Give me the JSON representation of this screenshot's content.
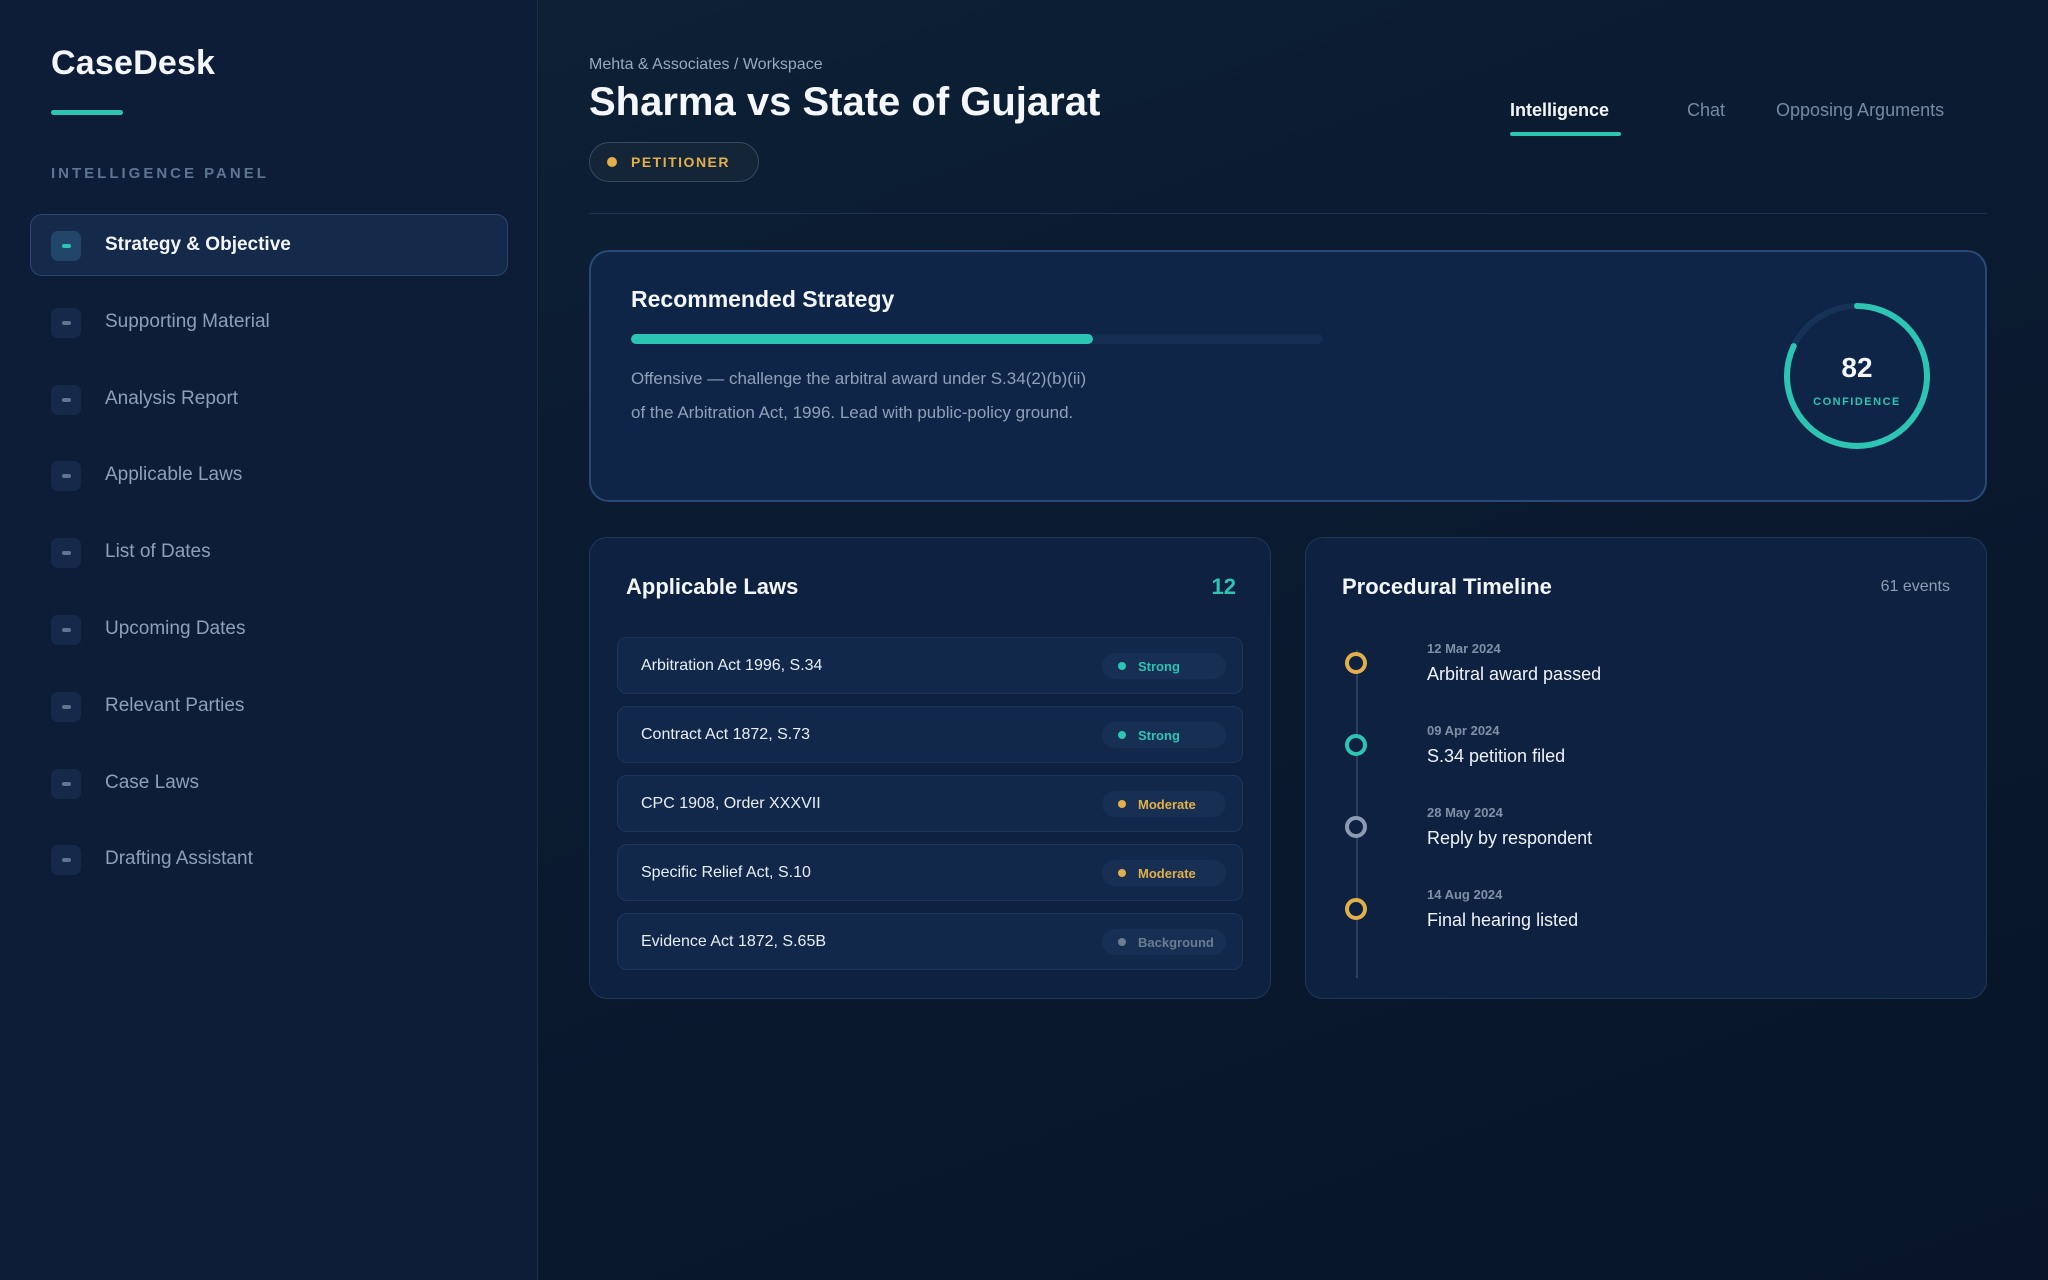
{
  "app": {
    "name": "CaseDesk"
  },
  "sidebar": {
    "panel_label": "INTELLIGENCE PANEL",
    "items": [
      {
        "label": "Strategy & Objective",
        "active": true
      },
      {
        "label": "Supporting Material"
      },
      {
        "label": "Analysis Report"
      },
      {
        "label": "Applicable Laws"
      },
      {
        "label": "List of Dates"
      },
      {
        "label": "Upcoming Dates"
      },
      {
        "label": "Relevant Parties"
      },
      {
        "label": "Case Laws"
      },
      {
        "label": "Drafting Assistant"
      }
    ]
  },
  "header": {
    "breadcrumb": "Mehta & Associates / Workspace",
    "title": "Sharma vs State of Gujarat",
    "role_badge": "PETITIONER",
    "tabs": [
      {
        "label": "Intelligence",
        "active": true
      },
      {
        "label": "Chat"
      },
      {
        "label": "Opposing Arguments"
      }
    ]
  },
  "strategy": {
    "title": "Recommended Strategy",
    "progress_fraction": 0.667,
    "description_line1": "Offensive — challenge the arbitral award under S.34(2)(b)(ii)",
    "description_line2": "of the Arbitration Act, 1996. Lead with public-policy ground.",
    "confidence_value": "82",
    "confidence_label": "CONFIDENCE",
    "confidence_fraction": 0.82
  },
  "laws": {
    "title": "Applicable Laws",
    "count": "12",
    "rows": [
      {
        "name": "Arbitration Act 1996, S.34",
        "strength": "Strong",
        "color": "#2cc5b4"
      },
      {
        "name": "Contract Act 1872, S.73",
        "strength": "Strong",
        "color": "#2cc5b4"
      },
      {
        "name": "CPC 1908, Order XXXVII",
        "strength": "Moderate",
        "color": "#e2b04a"
      },
      {
        "name": "Specific Relief Act, S.10",
        "strength": "Moderate",
        "color": "#e2b04a"
      },
      {
        "name": "Evidence Act 1872, S.65B",
        "strength": "Background",
        "color": "#6b7c93"
      }
    ]
  },
  "timeline": {
    "title": "Procedural Timeline",
    "events_count": "61 events",
    "events": [
      {
        "date": "12 Mar 2024",
        "text": "Arbitral award passed",
        "color": "#e2b04a"
      },
      {
        "date": "09 Apr 2024",
        "text": "S.34 petition filed",
        "color": "#2cc5b4"
      },
      {
        "date": "28 May 2024",
        "text": "Reply by respondent",
        "color": "#8d9bb0"
      },
      {
        "date": "14 Aug 2024",
        "text": "Final hearing listed",
        "color": "#e2b04a"
      }
    ]
  }
}
